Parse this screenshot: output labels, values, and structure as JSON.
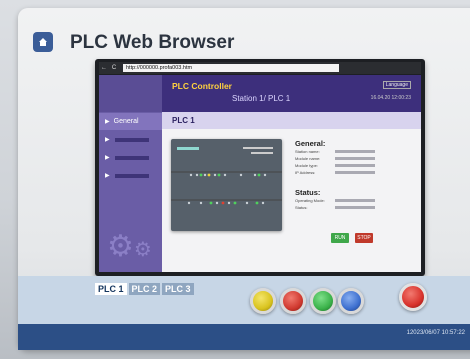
{
  "app": {
    "title": "PLC Web Browser"
  },
  "browser": {
    "back": "←",
    "reload": "C",
    "url": "http://000000.profa003.htm"
  },
  "page": {
    "header": {
      "title": "PLC Controller",
      "station": "Station 1/ PLC 1",
      "language": "Language",
      "timestamp": "16.04.20 12:00:23"
    },
    "section_title": "PLC 1",
    "sidebar": {
      "active_label": "General"
    },
    "general": {
      "heading": "General:",
      "fields": [
        "Station name:",
        "Module name:",
        "Module type:",
        "IP Address:"
      ]
    },
    "status": {
      "heading": "Status:",
      "fields": [
        "Operating Mode:",
        "Status:"
      ]
    },
    "buttons": {
      "run": "RUN",
      "stop": "STOP"
    }
  },
  "bottom": {
    "tabs": [
      "PLC 1",
      "PLC 2",
      "PLC 3"
    ],
    "knob_colors": [
      "#d9c31e",
      "#d0392f",
      "#3bb24a",
      "#3d6fcf"
    ],
    "emergency_color": "#d8322b",
    "timestamp": "12023/06/07 10:57:22"
  },
  "colors": {
    "accent": "#3d2f7c",
    "brand_blue": "#2c4f86",
    "run": "#3fa74a",
    "stop": "#c0392b"
  }
}
